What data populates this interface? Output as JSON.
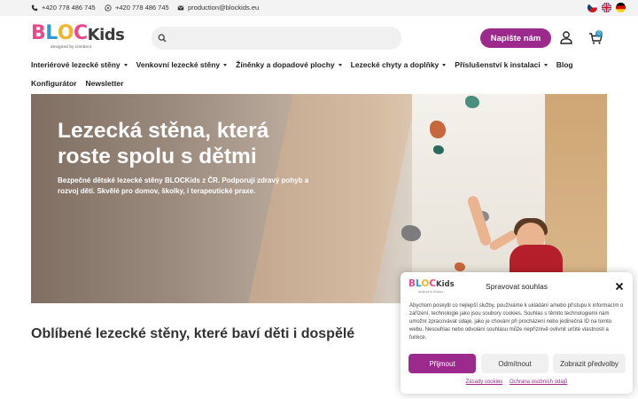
{
  "topbar": {
    "phone": "+420 778 486 745",
    "whatsapp": "+420 778 486 745",
    "email": "production@blockids.eu"
  },
  "brand": {
    "letters": [
      "B",
      "L",
      "O",
      "C",
      "Kids"
    ],
    "letter_colors": [
      "#e94b8a",
      "#2f9ad8",
      "#f2b42a",
      "#e94b8a",
      "#3a3a3a"
    ],
    "tagline": "designed by climbers"
  },
  "search": {
    "placeholder": ""
  },
  "header": {
    "cta_label": "Napište nám",
    "cart_count": "0"
  },
  "nav": {
    "row1": [
      {
        "label": "Interiérové lezecké stěny",
        "dropdown": true
      },
      {
        "label": "Venkovní lezecké stěny",
        "dropdown": true
      },
      {
        "label": "Žíněnky a dopadové plochy",
        "dropdown": true
      },
      {
        "label": "Lezecké chyty a doplňky",
        "dropdown": true
      },
      {
        "label": "Příslušenství k instalaci",
        "dropdown": true
      },
      {
        "label": "Blog",
        "dropdown": false
      }
    ],
    "row2": [
      {
        "label": "Konfigurátor"
      },
      {
        "label": "Newsletter"
      }
    ]
  },
  "hero": {
    "title_line1": "Lezecká stěna, která",
    "title_line2": "roste spolu s dětmi",
    "subtitle": "Bezpečné dětské lezecké stěny BLOCKids z ČR. Podporují zdravý pohyb a rozvoj dětí. Skvělé pro domov, školky, i terapeutické praxe."
  },
  "section": {
    "title": "Oblíbené lezecké stěny, které baví děti i dospělé"
  },
  "consent": {
    "title": "Spravovat souhlas",
    "text": "Abychom poskytli co nejlepší služby, používáme k ukládání a/nebo přístupu k informacím o zařízení, technologie jako jsou soubory cookies. Souhlas s těmito technologiemi nám umožní zpracovávat údaje, jako je chování při procházení nebo jedinečná ID na tomto webu. Nesouhlas nebo odvolání souhlasu může nepříznivě ovlivnit určité vlastnosti a funkce.",
    "accept": "Přijmout",
    "deny": "Odmítnout",
    "preferences": "Zobrazit předvolby",
    "link_cookies": "Zásady cookies",
    "link_privacy": "Ochrana osobních údajů"
  },
  "colors": {
    "accent": "#9c2a8c",
    "badge": "#2a8fc4"
  }
}
